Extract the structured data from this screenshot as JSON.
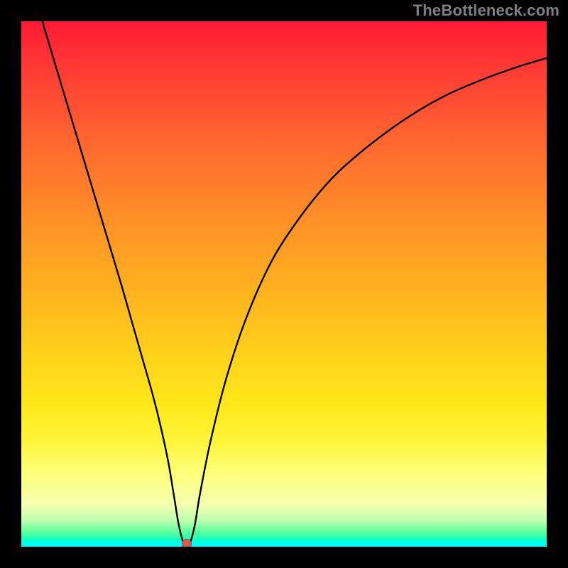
{
  "watermark": "TheBottleneck.com",
  "colors": {
    "frame": "#000000",
    "curve": "#000000",
    "dot": "#d95b52",
    "watermark": "#808080"
  },
  "chart_data": {
    "type": "line",
    "title": "",
    "xlabel": "",
    "ylabel": "",
    "xlim": [
      0,
      100
    ],
    "ylim": [
      0,
      100
    ],
    "grid": false,
    "x": [
      4,
      7,
      10,
      13,
      16,
      19,
      21,
      23,
      25,
      26.5,
      28,
      29,
      30,
      31,
      32,
      33,
      34,
      36,
      39,
      43,
      48,
      54,
      60,
      67,
      74,
      81,
      88,
      95,
      100
    ],
    "values": [
      100,
      90,
      80,
      70,
      60,
      50,
      43,
      36,
      29,
      23,
      16,
      10,
      4,
      0.5,
      0.5,
      4,
      10,
      20,
      32,
      44,
      55,
      64,
      71,
      77,
      82,
      86,
      89,
      91.5,
      93
    ],
    "marker": {
      "x": 31.5,
      "y": 0.6
    },
    "annotations": []
  }
}
